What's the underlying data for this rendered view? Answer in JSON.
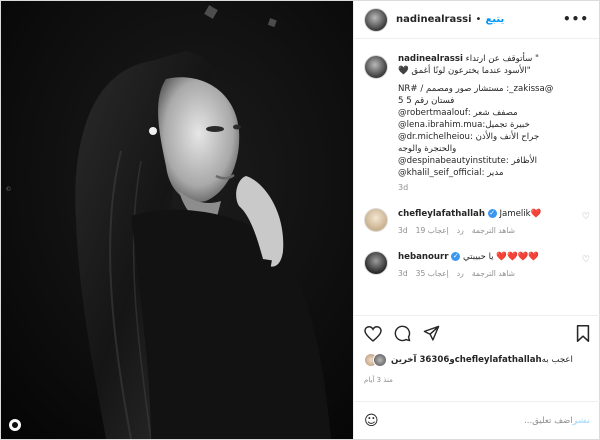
{
  "post": {
    "username": "nadinealrassi",
    "separator": "•",
    "follow": "يتبع",
    "more": "•••"
  },
  "caption": {
    "username": "nadinealrassi",
    "line1": "سأتوقف عن ارتداء \"",
    "line2": "\"الأسود عندما يخترعون لونًا أغمق 🖤",
    "line3": "NR# / مستشار صور ومصمم :_zakissa@",
    "line4": "فستان رقم 5 5",
    "line5": "مصفف شعر :robertmaalouf@",
    "line6": "خبيرة تجميل:lena.ibrahim.mua@",
    "line7": "جراح الأنف والأذن :dr.michelheiou@",
    "line8": "والحنجرة والوجه",
    "line9": "الأظافر :despinabeautyinstitute@",
    "line10": "مدير :khalil_seif_official@",
    "time": "3d"
  },
  "comments": [
    {
      "username": "chefleylafathallah",
      "text": "Jamelik❤️",
      "time": "3d",
      "likes": "19 إعجاب",
      "reply": "رد",
      "translate": "شاهد الترجمة"
    },
    {
      "username": "hebanourr",
      "text": "يا حبيبتي ❤️❤️❤️❤️",
      "time": "3d",
      "likes": "35 إعجاب",
      "reply": "رد",
      "translate": "شاهد الترجمة"
    }
  ],
  "likes": {
    "prefix": "اعجب به",
    "user": "chefleylafathallah",
    "rest": "و36306 آخرين"
  },
  "time_ago": "منذ 3 أيام",
  "add_comment": {
    "placeholder": "اضف تعليق...",
    "post": "نشر"
  },
  "colors": {
    "accent": "#0095f6",
    "heart": "#ed4956",
    "muted": "#8e8e8e"
  }
}
